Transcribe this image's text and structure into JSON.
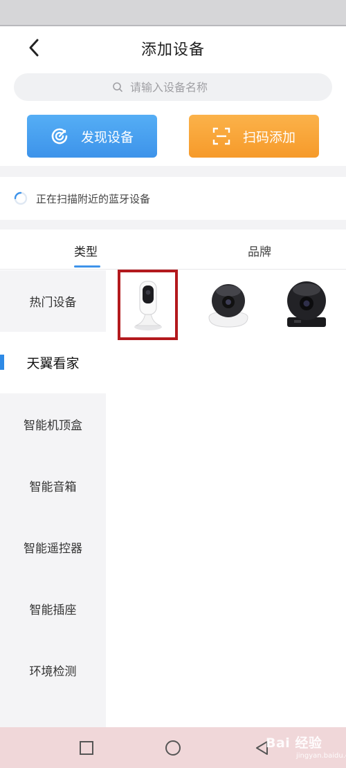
{
  "header": {
    "title": "添加设备"
  },
  "search": {
    "placeholder": "请输入设备名称"
  },
  "actions": {
    "discover_label": "发现设备",
    "scan_label": "扫码添加"
  },
  "scan_status": {
    "text": "正在扫描附近的蓝牙设备"
  },
  "tabs": [
    {
      "label": "类型"
    },
    {
      "label": "品牌"
    }
  ],
  "sidebar": {
    "items": [
      {
        "label": "热门设备"
      },
      {
        "label": "天翼看家"
      },
      {
        "label": "智能机顶盒"
      },
      {
        "label": "智能音箱"
      },
      {
        "label": "智能遥控器"
      },
      {
        "label": "智能插座"
      },
      {
        "label": "环境检测"
      }
    ],
    "active_index": 1
  },
  "devices": [
    {
      "icon": "white-camera-icon"
    },
    {
      "icon": "white-dome-camera-icon"
    },
    {
      "icon": "black-dome-camera-icon"
    }
  ],
  "watermark": {
    "text": "Bai 经验",
    "sub": "jingyan.baidu.com"
  },
  "colors": {
    "accent": "#3d93ea",
    "scan": "#f69a2a",
    "highlight": "#b3191d"
  }
}
